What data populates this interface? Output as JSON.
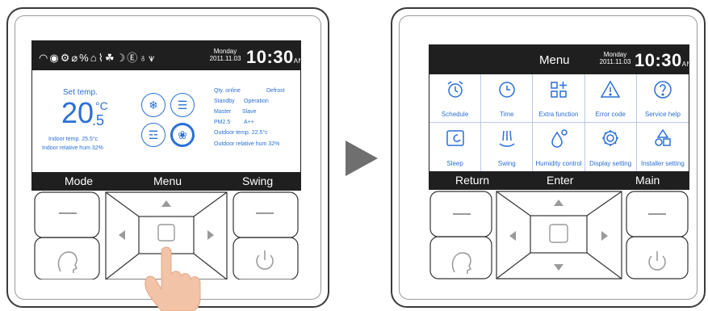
{
  "left_screen": {
    "status_icons": [
      "wifi-icon",
      "sun-icon",
      "gear-icon",
      "circle-slash-icon",
      "fan-percent-icon",
      "bell-icon",
      "heat-icon",
      "leaf-icon",
      "moon-icon",
      "eco-icon",
      "person-icon",
      "signal-icon"
    ],
    "day": "Monday",
    "date": "2011.11.03",
    "time": "10:30",
    "ampm": "AM",
    "set_temp_label": "Set temp.",
    "set_temp_main": "20",
    "set_temp_unit": "°C",
    "set_temp_decimal": ".5",
    "indoor_temp": "Indoor temp. 25.5°c",
    "indoor_hum": "Indoor relative hum 32%",
    "info": {
      "qty": "Qty. online",
      "defrost": "Defrost",
      "standby": "Standby",
      "operation": "Operation",
      "master": "Master",
      "slave": "Slave",
      "pm": "PM2.5",
      "pm_val": "A++",
      "outdoor_temp": "Outdoor temp. 22.5°c",
      "outdoor_hum": "Outdoor relative hum 32%"
    },
    "softkeys": {
      "left": "Mode",
      "center": "Menu",
      "right": "Swing"
    }
  },
  "right_screen": {
    "title": "Menu",
    "day": "Monday",
    "date": "2011.11.03",
    "time": "10:30",
    "ampm": "AM",
    "menu_items": [
      {
        "label": "Schedule",
        "icon": "alarm-clock-icon"
      },
      {
        "label": "Time",
        "icon": "clock-icon"
      },
      {
        "label": "Extra function",
        "icon": "grid-plus-icon"
      },
      {
        "label": "Error code",
        "icon": "warning-icon"
      },
      {
        "label": "Service help",
        "icon": "question-icon"
      },
      {
        "label": "Sleep",
        "icon": "sleep-icon"
      },
      {
        "label": "Swing",
        "icon": "swing-icon"
      },
      {
        "label": "Humidity control",
        "icon": "humidity-icon"
      },
      {
        "label": "Display setting",
        "icon": "gear-icon"
      },
      {
        "label": "Installer setting",
        "icon": "shapes-icon"
      }
    ],
    "softkeys": {
      "left": "Return",
      "center": "Enter",
      "right": "Main"
    }
  },
  "colors": {
    "accent": "#2b6fd6",
    "bar": "#1f1f1f",
    "arrow": "#6f6f6f"
  }
}
